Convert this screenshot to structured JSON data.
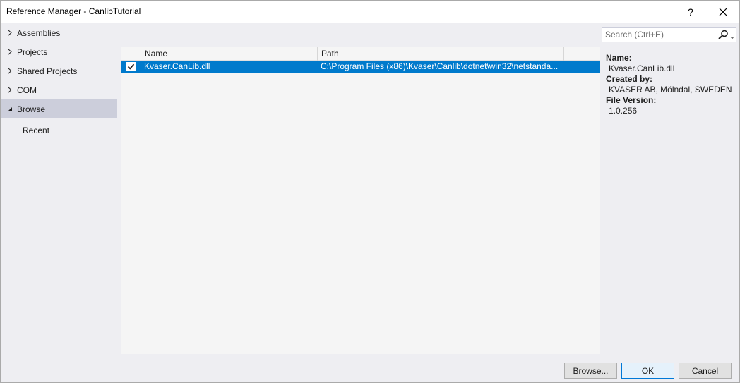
{
  "window": {
    "title": "Reference Manager - CanlibTutorial",
    "help_label": "?",
    "close_label": "✕"
  },
  "nav": {
    "items": [
      {
        "label": "Assemblies",
        "expanded": false
      },
      {
        "label": "Projects",
        "expanded": false
      },
      {
        "label": "Shared Projects",
        "expanded": false
      },
      {
        "label": "COM",
        "expanded": false
      },
      {
        "label": "Browse",
        "expanded": true,
        "selected": true
      }
    ],
    "sub_items": [
      {
        "label": "Recent"
      }
    ]
  },
  "list": {
    "columns": [
      "",
      "Name",
      "Path"
    ],
    "rows": [
      {
        "checked": true,
        "selected": true,
        "name": "Kvaser.CanLib.dll",
        "path": "C:\\Program Files (x86)\\Kvaser\\Canlib\\dotnet\\win32\\netstanda..."
      }
    ]
  },
  "search": {
    "placeholder": "Search (Ctrl+E)",
    "icon": "search-icon"
  },
  "details": {
    "name_label": "Name:",
    "name_value": "Kvaser.CanLib.dll",
    "created_label": "Created by:",
    "created_value": "KVASER AB, Mölndal, SWEDEN",
    "version_label": "File Version:",
    "version_value": "1.0.256"
  },
  "buttons": {
    "browse": "Browse...",
    "ok": "OK",
    "cancel": "Cancel"
  },
  "colors": {
    "selection": "#007acc",
    "nav_selected": "#cccedb",
    "background": "#eeeef2"
  }
}
